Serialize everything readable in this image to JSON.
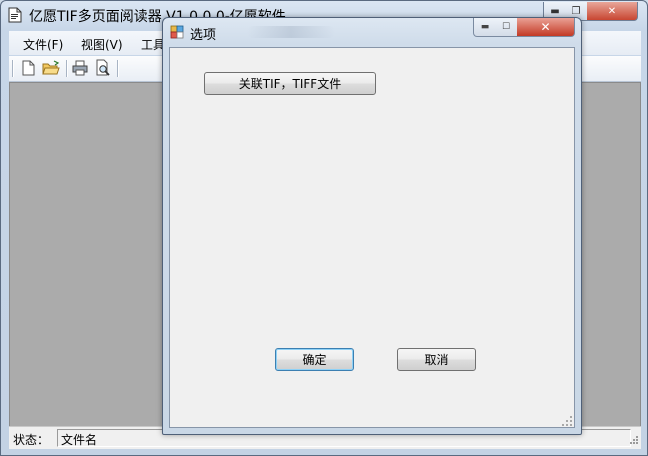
{
  "main_window": {
    "title": "亿愿TIF多页面阅读器 V1.0.0.0-亿愿软件",
    "menu": [
      "文件(F)",
      "视图(V)",
      "工具"
    ],
    "toolbar": [
      "new-file-icon",
      "open-folder-icon",
      "print-icon",
      "print-preview-icon"
    ],
    "status": {
      "label": "状态：",
      "value": "文件名"
    }
  },
  "dialog": {
    "title": "选项",
    "assoc_button": "关联TIF，TIFF文件",
    "ok": "确定",
    "cancel": "取消"
  },
  "colors": {
    "workspace": "#ababab",
    "dialog_client": "#f0f0f0",
    "close_button": "#c84631",
    "default_button_border": "#3c7fb1"
  }
}
